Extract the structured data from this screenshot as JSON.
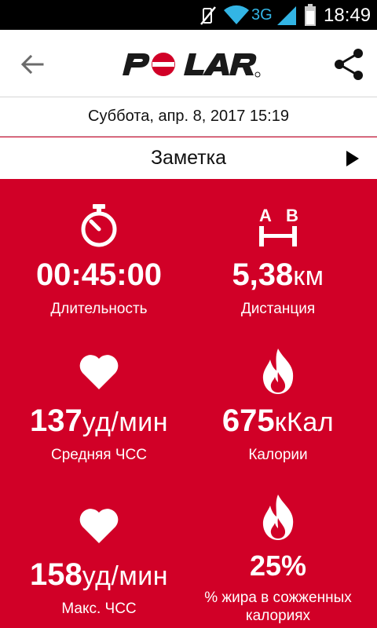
{
  "status_bar": {
    "network": "3G",
    "time": "18:49",
    "icons": [
      "vibrate-off-icon",
      "wifi-icon",
      "signal-icon",
      "battery-icon"
    ]
  },
  "app_bar": {
    "logo_text": "POLAR",
    "icons": [
      "back-arrow-icon",
      "share-icon"
    ]
  },
  "session": {
    "datetime": "Суббота, апр. 8, 2017 15:19",
    "note_label": "Заметка"
  },
  "stats": {
    "duration": {
      "value": "00:45:00",
      "unit": "",
      "label": "Длительность",
      "icon": "stopwatch-icon"
    },
    "distance": {
      "value": "5,38",
      "unit": "км",
      "label": "Дистанция",
      "icon": "a-b-distance-icon",
      "icon_letters": [
        "A",
        "B"
      ]
    },
    "avg_hr": {
      "value": "137",
      "unit": "уд/мин",
      "label": "Средняя ЧСС",
      "icon": "heart-icon"
    },
    "calories": {
      "value": "675",
      "unit": "кКал",
      "label": "Калории",
      "icon": "flame-icon"
    },
    "max_hr": {
      "value": "158",
      "unit": "уд/мин",
      "label": "Макс. ЧСС",
      "icon": "heart-icon"
    },
    "fat_pct": {
      "value": "25%",
      "unit": "",
      "label": "% жира в сожженных калориях",
      "icon": "flame-icon"
    }
  },
  "colors": {
    "brand_red": "#d10027",
    "status_accent": "#33b5e5"
  }
}
